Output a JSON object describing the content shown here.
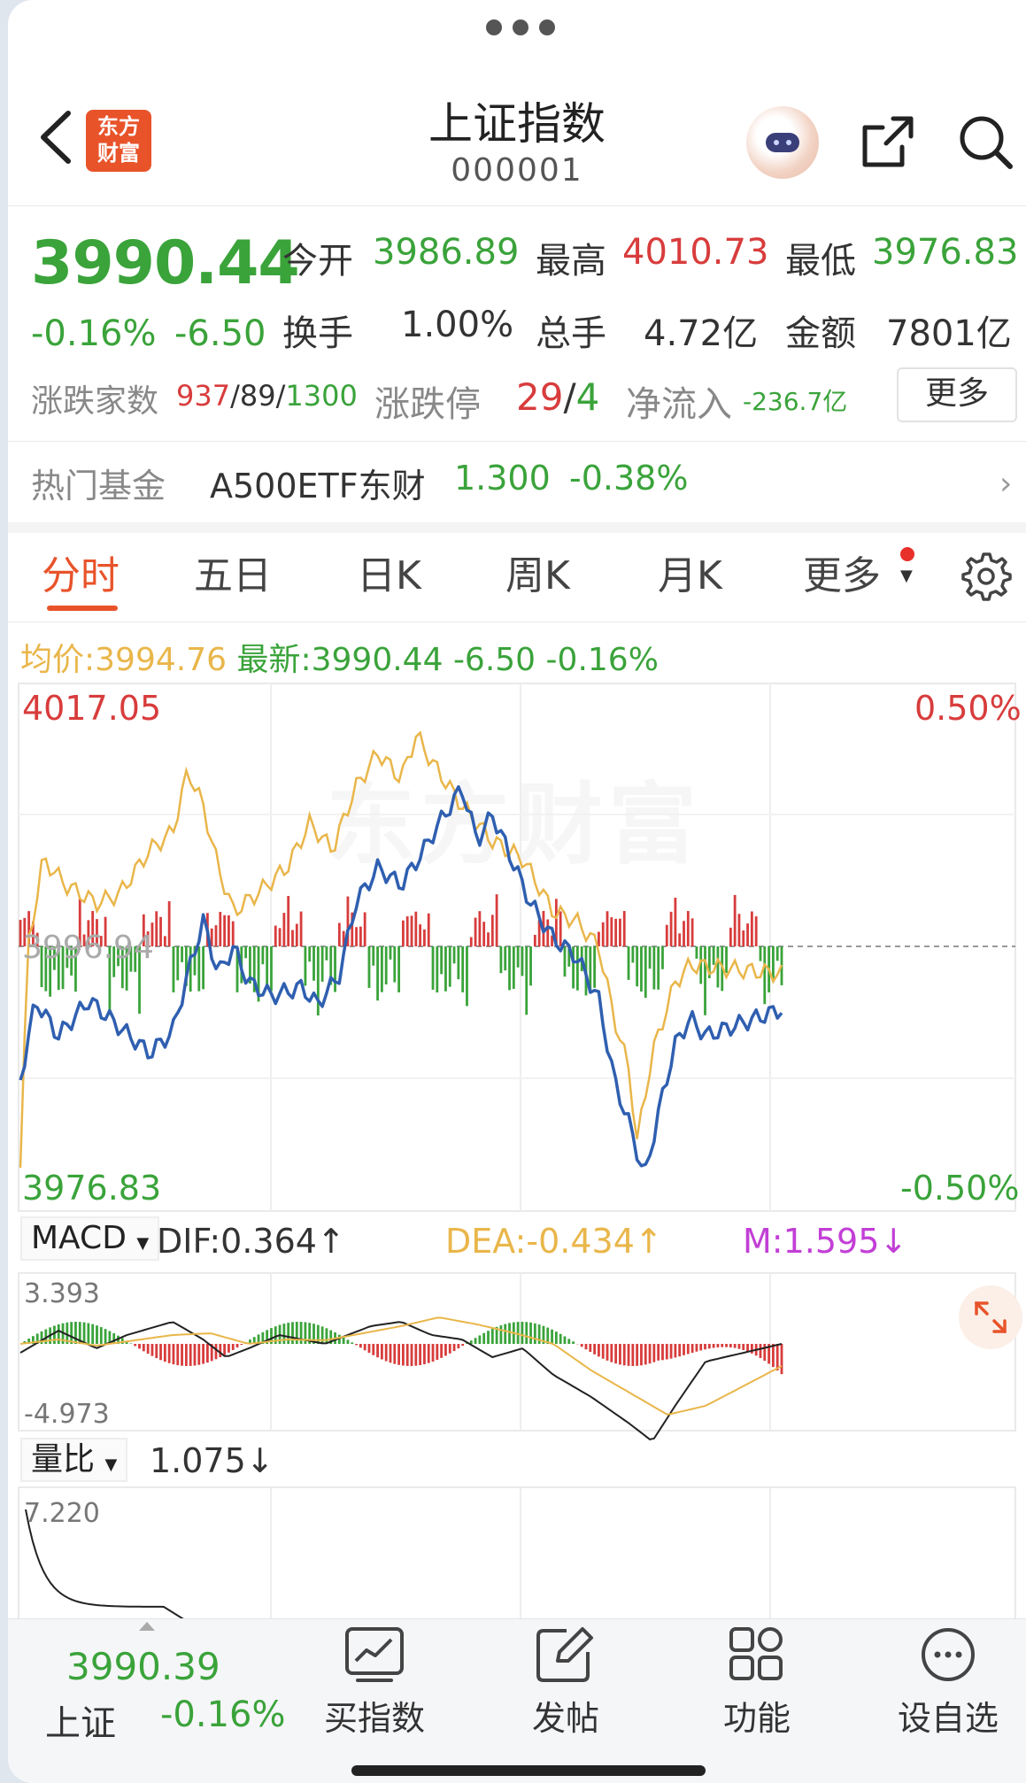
{
  "header": {
    "title": "上证指数",
    "code": "000001",
    "logo_line1": "东方",
    "logo_line2": "财富"
  },
  "quote": {
    "price": "3990.44",
    "change_pct": "-0.16%",
    "change_abs": "-6.50",
    "open_label": "今开",
    "open": "3986.89",
    "high_label": "最高",
    "high": "4010.73",
    "low_label": "最低",
    "low": "3976.83",
    "turnover_label": "换手",
    "turnover": "1.00%",
    "volume_label": "总手",
    "volume": "4.72亿",
    "amount_label": "金额",
    "amount": "7801亿",
    "breadth_label": "涨跌家数",
    "breadth_up": "937",
    "breadth_flat": "89",
    "breadth_down": "1300",
    "limit_label": "涨跌停",
    "limit_up": "29",
    "limit_down": "4",
    "netflow_label": "净流入",
    "netflow": "-236.7亿",
    "more": "更多",
    "slash": "/"
  },
  "fund": {
    "label": "热门基金",
    "name": "A500ETF东财",
    "price": "1.300",
    "pct": "-0.38%",
    "chevron": "›"
  },
  "tabs": [
    {
      "label": "分时"
    },
    {
      "label": "五日"
    },
    {
      "label": "日K"
    },
    {
      "label": "周K"
    },
    {
      "label": "月K"
    },
    {
      "label": "更多"
    }
  ],
  "avg_row": {
    "avg_label": "均价:",
    "avg": "3994.76",
    "latest_label": "最新:",
    "latest": "3990.44",
    "chg": "-6.50",
    "pct": "-0.16%"
  },
  "price_chart": {
    "ymax": "4017.05",
    "ymin": "3976.83",
    "pct_max": "0.50%",
    "pct_min": "-0.50%",
    "prev_close": "3996.94",
    "watermark": "东方财富"
  },
  "macd": {
    "label": "MACD",
    "dif": "DIF:0.364↑",
    "dea": "DEA:-0.434↑",
    "m": "M:1.595↓",
    "ymax": "3.393",
    "ymin": "-4.973"
  },
  "volume_ratio": {
    "label": "量比",
    "value": "1.075↓",
    "ymax": "7.220"
  },
  "bottom_bar": {
    "index_price": "3990.39",
    "index_name": "上证",
    "index_pct": "-0.16%",
    "items": [
      {
        "label": "买指数",
        "icon": "chart-trend-icon"
      },
      {
        "label": "发帖",
        "icon": "edit-icon"
      },
      {
        "label": "功能",
        "icon": "grid-icon"
      },
      {
        "label": "设自选",
        "icon": "more-icon"
      }
    ]
  },
  "colors": {
    "up": "#d83c3c",
    "down": "#3aa33a",
    "avg_line": "#e9b64a",
    "price_line": "#2f5fb0",
    "accent": "#e8532a",
    "m_color": "#c23fd6"
  }
}
